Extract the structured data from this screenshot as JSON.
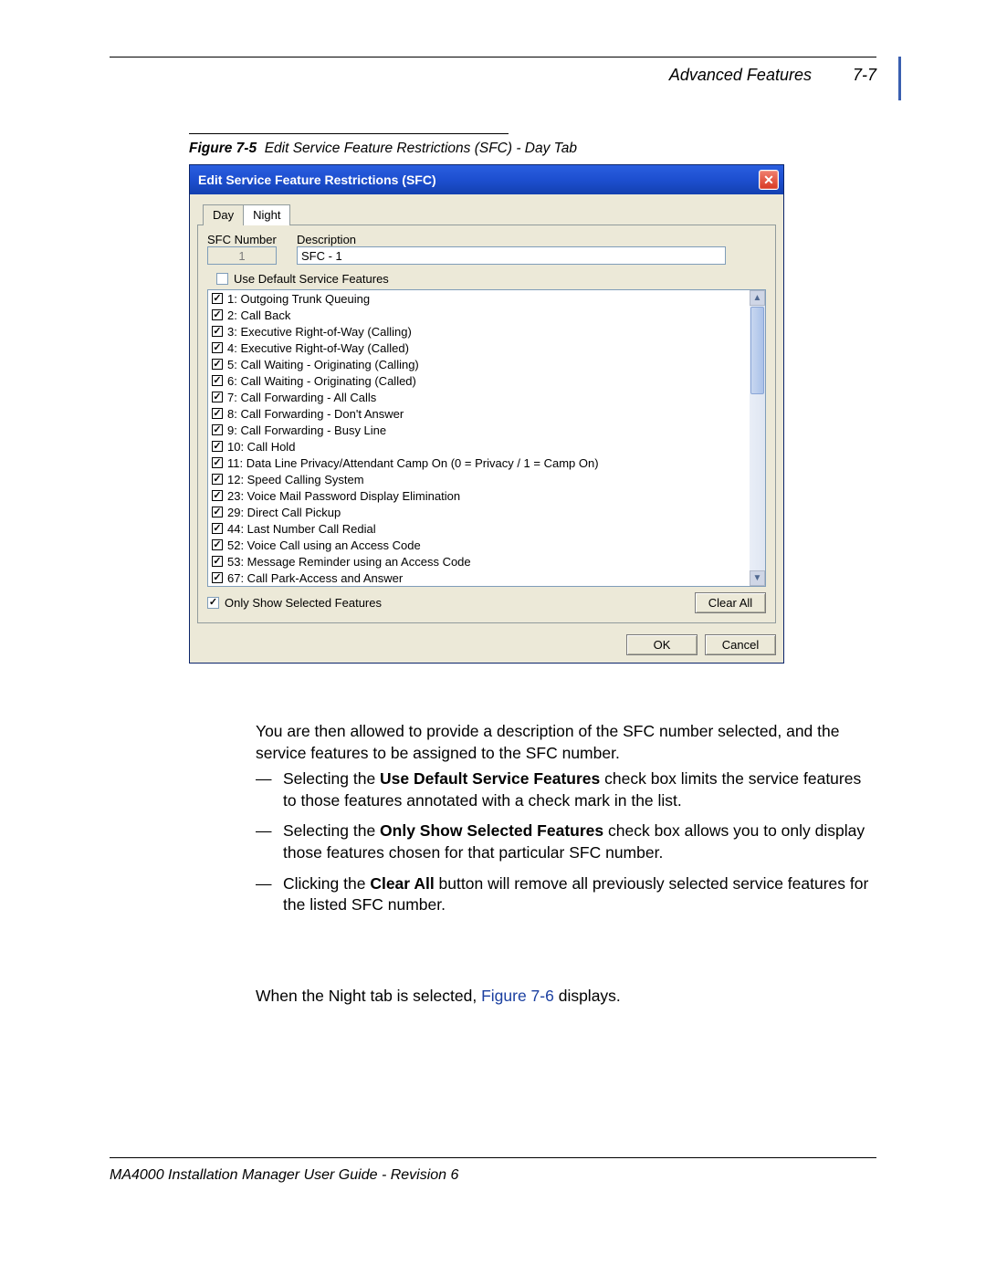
{
  "header": {
    "section": "Advanced Features",
    "page": "7-7"
  },
  "figure": {
    "ref": "Figure 7-5",
    "title": "Edit Service Feature Restrictions (SFC) - Day Tab"
  },
  "dialog": {
    "title": "Edit Service Feature Restrictions (SFC)",
    "tabs": {
      "day": "Day",
      "night": "Night"
    },
    "labels": {
      "sfc_number": "SFC Number",
      "description": "Description"
    },
    "fields": {
      "sfc_number": "1",
      "description": "SFC - 1"
    },
    "use_default_label": "Use Default Service Features",
    "use_default_checked": false,
    "features": [
      {
        "num": "1",
        "label": "Outgoing Trunk Queuing",
        "checked": true
      },
      {
        "num": "2",
        "label": "Call Back",
        "checked": true
      },
      {
        "num": "3",
        "label": "Executive Right-of-Way (Calling)",
        "checked": true
      },
      {
        "num": "4",
        "label": "Executive Right-of-Way (Called)",
        "checked": true
      },
      {
        "num": "5",
        "label": "Call Waiting - Originating (Calling)",
        "checked": true
      },
      {
        "num": "6",
        "label": "Call Waiting - Originating (Called)",
        "checked": true
      },
      {
        "num": "7",
        "label": "Call Forwarding - All Calls",
        "checked": true
      },
      {
        "num": "8",
        "label": "Call Forwarding - Don't Answer",
        "checked": true
      },
      {
        "num": "9",
        "label": "Call Forwarding - Busy Line",
        "checked": true
      },
      {
        "num": "10",
        "label": "Call Hold",
        "checked": true
      },
      {
        "num": "11",
        "label": "Data Line Privacy/Attendant Camp On (0 = Privacy / 1 = Camp On)",
        "checked": true
      },
      {
        "num": "12",
        "label": "Speed Calling System",
        "checked": true
      },
      {
        "num": "23",
        "label": "Voice Mail Password Display Elimination",
        "checked": true
      },
      {
        "num": "29",
        "label": "Direct Call Pickup",
        "checked": true
      },
      {
        "num": "44",
        "label": "Last Number Call Redial",
        "checked": true
      },
      {
        "num": "52",
        "label": "Voice Call using an Access Code",
        "checked": true
      },
      {
        "num": "53",
        "label": "Message Reminder using an Access Code",
        "checked": true
      },
      {
        "num": "67",
        "label": "Call Park-Access and Answer",
        "checked": true
      }
    ],
    "only_show_label": "Only Show Selected Features",
    "only_show_checked": true,
    "buttons": {
      "clear_all": "Clear All",
      "ok": "OK",
      "cancel": "Cancel"
    }
  },
  "body": {
    "intro": "You are then allowed to provide a description of the SFC number selected, and the service features to be assigned to the SFC number.",
    "bullets": [
      {
        "pre": "Selecting the ",
        "bold": "Use Default Service Features",
        "post": " check box limits the service features to those features annotated with a check mark in the list."
      },
      {
        "pre": "Selecting the ",
        "bold": "Only Show Selected Features",
        "post": " check box allows you to only display those features chosen for that particular SFC number."
      },
      {
        "pre": "Clicking the ",
        "bold": "Clear All",
        "post": " button will remove all previously selected service features for the listed SFC number."
      }
    ],
    "night_pre": "When the Night tab is selected, ",
    "night_link": "Figure 7-6",
    "night_post": " displays."
  },
  "footer": "MA4000 Installation Manager User Guide - Revision 6"
}
